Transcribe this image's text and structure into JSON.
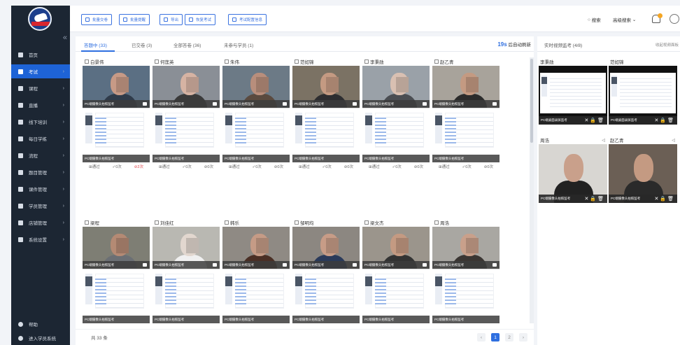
{
  "colors": {
    "primary": "#2f6fe0",
    "sidebar_bg": "#1c2633",
    "danger": "#e0444a"
  },
  "sidebar": {
    "items": [
      {
        "label": "首页",
        "icon": "grid-icon"
      },
      {
        "label": "考试",
        "icon": "exam-icon",
        "active": true
      },
      {
        "label": "课程",
        "icon": "book-icon"
      },
      {
        "label": "直播",
        "icon": "live-icon"
      },
      {
        "label": "线下培训",
        "icon": "training-icon"
      },
      {
        "label": "每日学练",
        "icon": "practice-icon"
      },
      {
        "label": "流程",
        "icon": "flow-icon"
      },
      {
        "label": "题目管理",
        "icon": "question-icon"
      },
      {
        "label": "课件管理",
        "icon": "folder-icon"
      },
      {
        "label": "学员管理",
        "icon": "user-icon"
      },
      {
        "label": "店铺管理",
        "icon": "shop-icon"
      },
      {
        "label": "系统设置",
        "icon": "gear-icon"
      }
    ],
    "help": "帮助",
    "enter_student": "进入学员系统"
  },
  "toolbar": {
    "batch_submit": "批量交卷",
    "batch_remind": "批量提醒",
    "export": "导出",
    "resume_exam": "恢复考试",
    "exam_config": "考试配置信息",
    "search": "搜索",
    "advanced_search": "高级搜索"
  },
  "tabs": [
    {
      "label": "答题中 (33)",
      "active": true
    },
    {
      "label": "已交卷 (3)"
    },
    {
      "label": "全部答卷 (36)"
    },
    {
      "label": "未参与学员 (1)"
    }
  ],
  "refresh": {
    "seconds": "19s",
    "text": "后自动刷新"
  },
  "cam_label": "PC端摄像头拍照监考",
  "stats_labels": {
    "pass": "通过",
    "a": "0次",
    "b": "0次",
    "c_warn": "2次"
  },
  "row1": [
    {
      "name": "白景伟",
      "warn": true
    },
    {
      "name": "何莲英"
    },
    {
      "name": "朱伟"
    },
    {
      "name": "范如锦"
    },
    {
      "name": "李秉勋"
    },
    {
      "name": "赵乙青"
    }
  ],
  "row2": [
    {
      "name": "梁程"
    },
    {
      "name": "刘佳红"
    },
    {
      "name": "韩乐"
    },
    {
      "name": "邹明均"
    },
    {
      "name": "梁文杰"
    },
    {
      "name": "周浩"
    }
  ],
  "footer": {
    "total": "共 33 条",
    "pages": [
      "1",
      "2"
    ]
  },
  "right_panel": {
    "title": "实时视频监考 (4/8)",
    "collapse": "收起视频面板",
    "screen_label": "PC端桌面录屏监考",
    "cam_label": "PC端摄像头拍照监考",
    "cards": [
      {
        "name": "李秉勋",
        "type": "screen"
      },
      {
        "name": "范如锦",
        "type": "screen"
      },
      {
        "name": "周浩",
        "type": "cam"
      },
      {
        "name": "赵乙青",
        "type": "cam"
      }
    ]
  }
}
